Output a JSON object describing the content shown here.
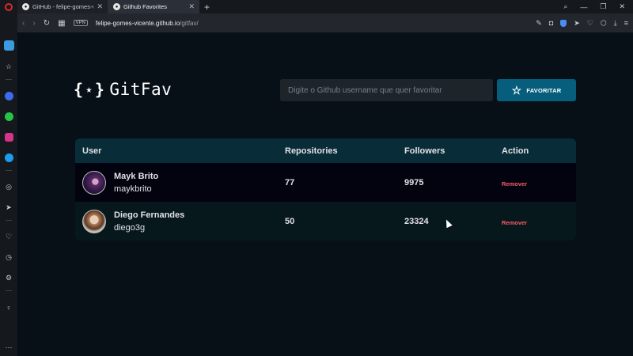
{
  "browser": {
    "tabs": [
      {
        "title": "GitHub - felipe-gomes-vice",
        "favicon": "github-icon",
        "active": false
      },
      {
        "title": "Github Favorites",
        "favicon": "github-icon",
        "active": true
      }
    ],
    "new_tab_glyph": "+",
    "vpn_label": "VPN",
    "url_host": "felipe-gomes-vicente.github.io",
    "url_path": "/gitfav/"
  },
  "app": {
    "logo_text": "GitFav",
    "search_placeholder": "Digite o Github username que quer favoritar",
    "favorite_button": "FAVORITAR"
  },
  "table": {
    "headers": {
      "user": "User",
      "repos": "Repositories",
      "followers": "Followers",
      "action": "Action"
    },
    "rows": [
      {
        "name": "Mayk Brito",
        "login": "maykbrito",
        "repos": "77",
        "followers": "9975",
        "action": "Remover"
      },
      {
        "name": "Diego Fernandes",
        "login": "diego3g",
        "repos": "50",
        "followers": "23324",
        "action": "Remover"
      }
    ]
  },
  "colors": {
    "page_bg": "#061016",
    "accent": "#065e7c",
    "remove": "#f75a68",
    "header": "#092d38"
  }
}
